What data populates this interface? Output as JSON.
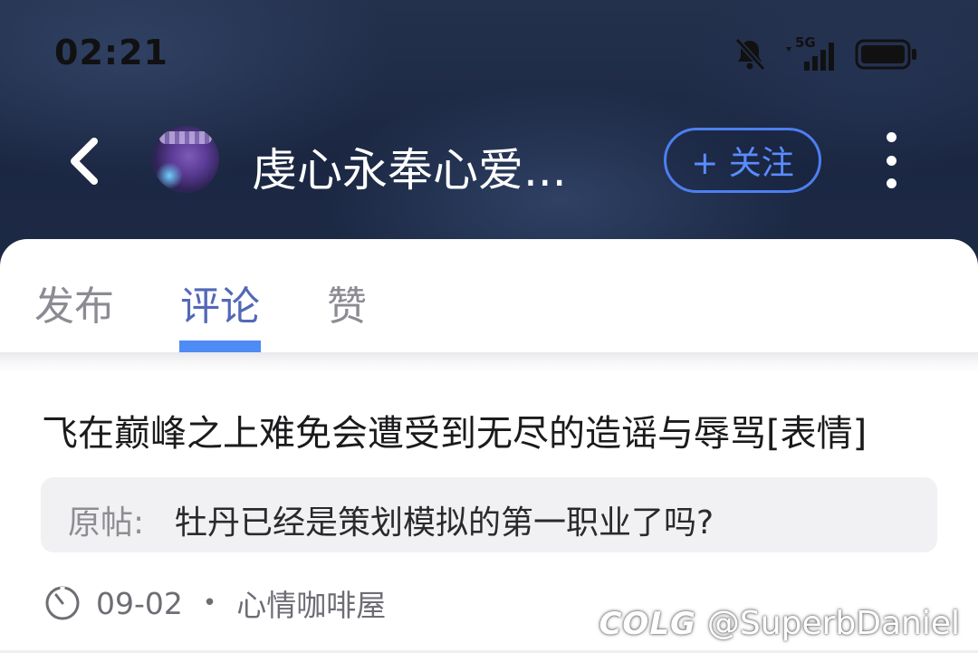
{
  "status_bar": {
    "time": "02:21",
    "network": "5G"
  },
  "header": {
    "back_icon": "chevron-left-icon",
    "title": "虔心永奉心爱...",
    "follow_label": "+ 关注",
    "more_icon": "more-vertical-icon"
  },
  "tabs": [
    {
      "label": "发布",
      "active": false
    },
    {
      "label": "评论",
      "active": true
    },
    {
      "label": "赞",
      "active": false
    }
  ],
  "comment": {
    "text": "飞在巅峰之上难免会遭受到无尽的造谣与辱骂[表情]",
    "quote_label": "原帖:",
    "quote_text": "牡丹已经是策划模拟的第一职业了吗?",
    "date": "09-02",
    "separator": "•",
    "board": "心情咖啡屋"
  },
  "watermark": {
    "brand": "COLG",
    "handle": "@SuperbDaniel"
  },
  "colors": {
    "accent": "#4e8bf5",
    "active_tab": "#5268b8",
    "header_bg": "#1d2a46"
  }
}
